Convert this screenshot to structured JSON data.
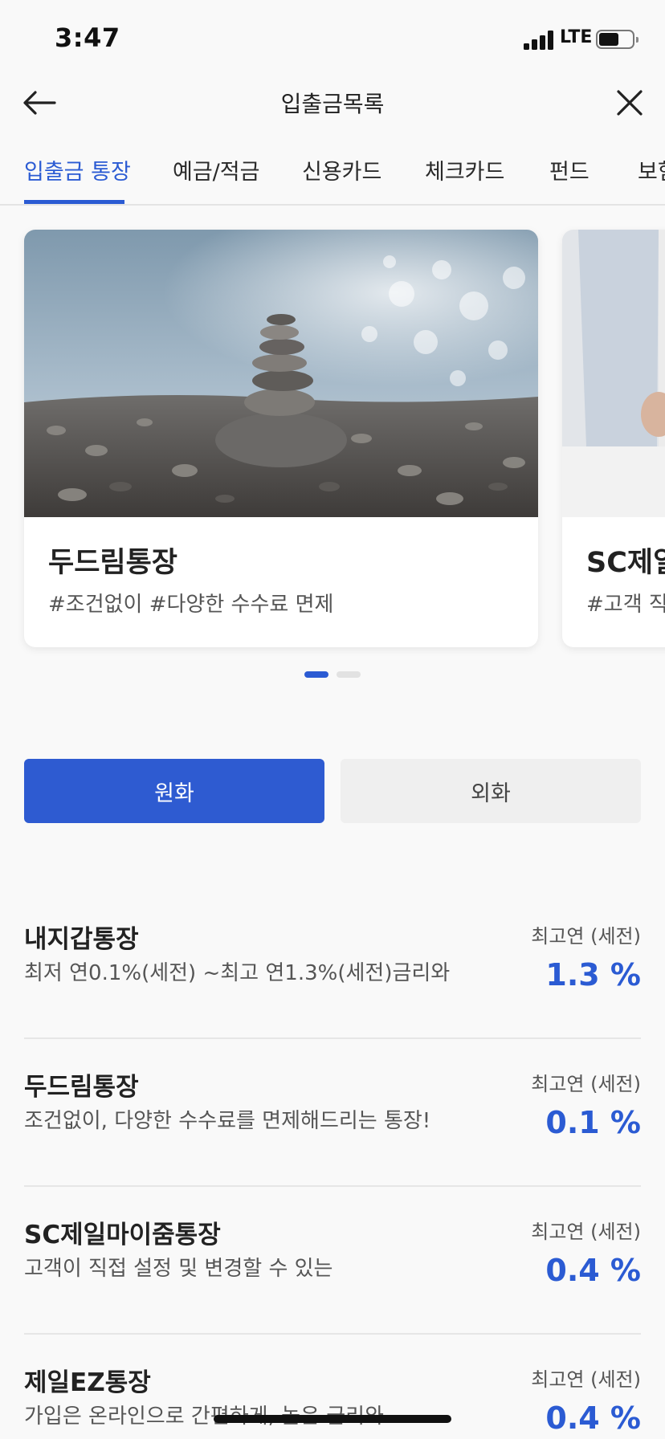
{
  "status_bar": {
    "time": "3:47",
    "network": "LTE"
  },
  "header": {
    "title": "입출금목록"
  },
  "tabs": [
    {
      "label": "입출금 통장",
      "active": true
    },
    {
      "label": "예금/적금",
      "active": false
    },
    {
      "label": "신용카드",
      "active": false
    },
    {
      "label": "체크카드",
      "active": false
    },
    {
      "label": "펀드",
      "active": false
    },
    {
      "label": "보험",
      "active": false
    }
  ],
  "carousel": {
    "cards": [
      {
        "title": "두드림통장",
        "tags": "#조건없이 #다양한 수수료 면제"
      },
      {
        "title": "SC제일",
        "tags": "#고객 직"
      }
    ],
    "page_count": 2,
    "current_page": 1
  },
  "currency_toggle": {
    "krw_label": "원화",
    "fx_label": "외화",
    "selected": "원화"
  },
  "products": [
    {
      "name": "내지갑통장",
      "desc": "최저 연0.1%(세전) ~최고 연1.3%(세전)금리와",
      "rate_label": "최고연 (세전)",
      "rate": "1.3 %"
    },
    {
      "name": "두드림통장",
      "desc": "조건없이, 다양한 수수료를 면제해드리는 통장!",
      "rate_label": "최고연 (세전)",
      "rate": "0.1 %"
    },
    {
      "name": "SC제일마이줌통장",
      "desc": "고객이 직접 설정 및 변경할 수 있는",
      "rate_label": "최고연 (세전)",
      "rate": "0.4 %"
    },
    {
      "name": "제일EZ통장",
      "desc": "가입은 온라인으로 간편하게, 높은 금리와",
      "rate_label": "최고연 (세전)",
      "rate": "0.4 %"
    }
  ],
  "colors": {
    "accent": "#2b5bd3",
    "segment_active": "#2e5bd1",
    "segment_inactive": "#efefef",
    "background": "#f9f9f9"
  },
  "icons": {
    "back": "arrow-left-icon",
    "close": "close-icon",
    "signal": "signal-icon",
    "battery": "battery-icon"
  }
}
